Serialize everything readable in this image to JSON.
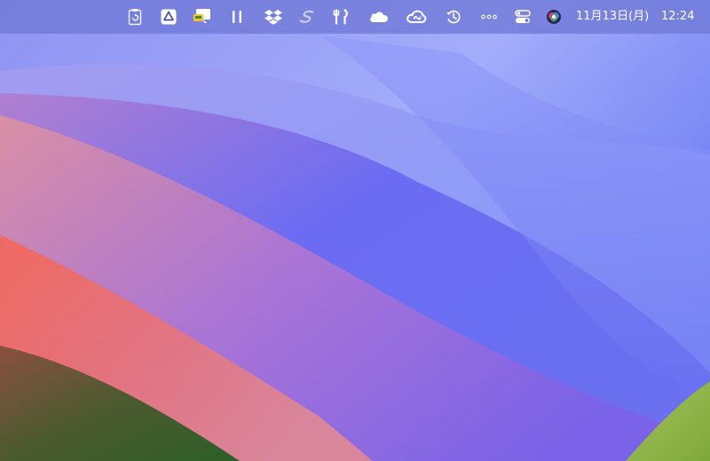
{
  "desktop": {
    "wallpaper": "macos-sonoma-wallpaper",
    "colors": {
      "sky_light": "#a7b2fb",
      "sky_blue": "#6a74f2",
      "pink": "#d98aa3",
      "red": "#ef6960",
      "dark_green": "#2f5e2a",
      "lime": "#94b94b",
      "menubar": "#7078d6"
    }
  },
  "menubar": {
    "status_icons": [
      "clipboard-history-icon",
      "google-drive-icon",
      "screen-capture-icon",
      "pause-icon",
      "dropbox-icon",
      "setapp-icon",
      "wifi-toolbox-icon",
      "icloud-icon",
      "creative-cloud-icon",
      "time-machine-icon",
      "more-dots-icon",
      "control-center-icon",
      "siri-icon"
    ],
    "clock": {
      "date": "11月13日(月)",
      "time": "12:24"
    }
  }
}
